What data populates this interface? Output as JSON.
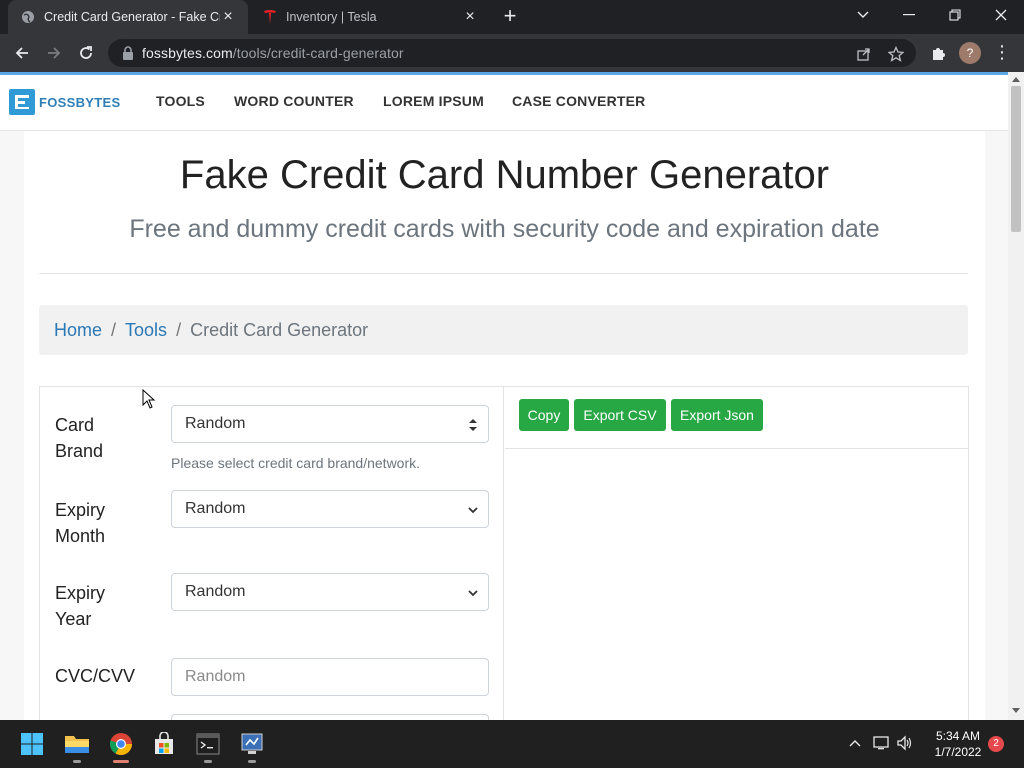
{
  "browser": {
    "tabs": [
      {
        "title": "Credit Card Generator - Fake Credit Card Number Generator",
        "active": true
      },
      {
        "title": "Inventory | Tesla",
        "active": false
      }
    ],
    "url_domain": "fossbytes.com",
    "url_path": "/tools/credit-card-generator",
    "profile_initial": "?"
  },
  "site": {
    "logo_text": "FOSSBYTES",
    "nav": [
      "TOOLS",
      "WORD COUNTER",
      "LOREM IPSUM",
      "CASE CONVERTER"
    ]
  },
  "main": {
    "title": "Fake Credit Card Number Generator",
    "subtitle": "Free and dummy credit cards with security code and expiration date",
    "breadcrumb": {
      "home": "Home",
      "tools": "Tools",
      "current": "Credit Card Generator",
      "separator": "/"
    }
  },
  "form": {
    "card_brand": {
      "label": "Card Brand",
      "value": "Random",
      "help": "Please select credit card brand/network."
    },
    "expiry_month": {
      "label": "Expiry Month",
      "value": "Random"
    },
    "expiry_year": {
      "label": "Expiry Year",
      "value": "Random"
    },
    "cvc": {
      "label": "CVC/CVV",
      "placeholder": "Random"
    }
  },
  "actions": {
    "copy": "Copy",
    "export_csv": "Export CSV",
    "export_json": "Export Json"
  },
  "taskbar": {
    "apps": [
      "start-icon",
      "file-explorer-icon",
      "chrome-icon",
      "store-icon",
      "terminal-icon",
      "app-icon"
    ],
    "time": "5:34 AM",
    "date": "1/7/2022",
    "notifications": "2"
  },
  "colors": {
    "accent_green": "#28a745",
    "link_blue": "#2a78b5",
    "brand_blue": "#2f9ad6"
  }
}
